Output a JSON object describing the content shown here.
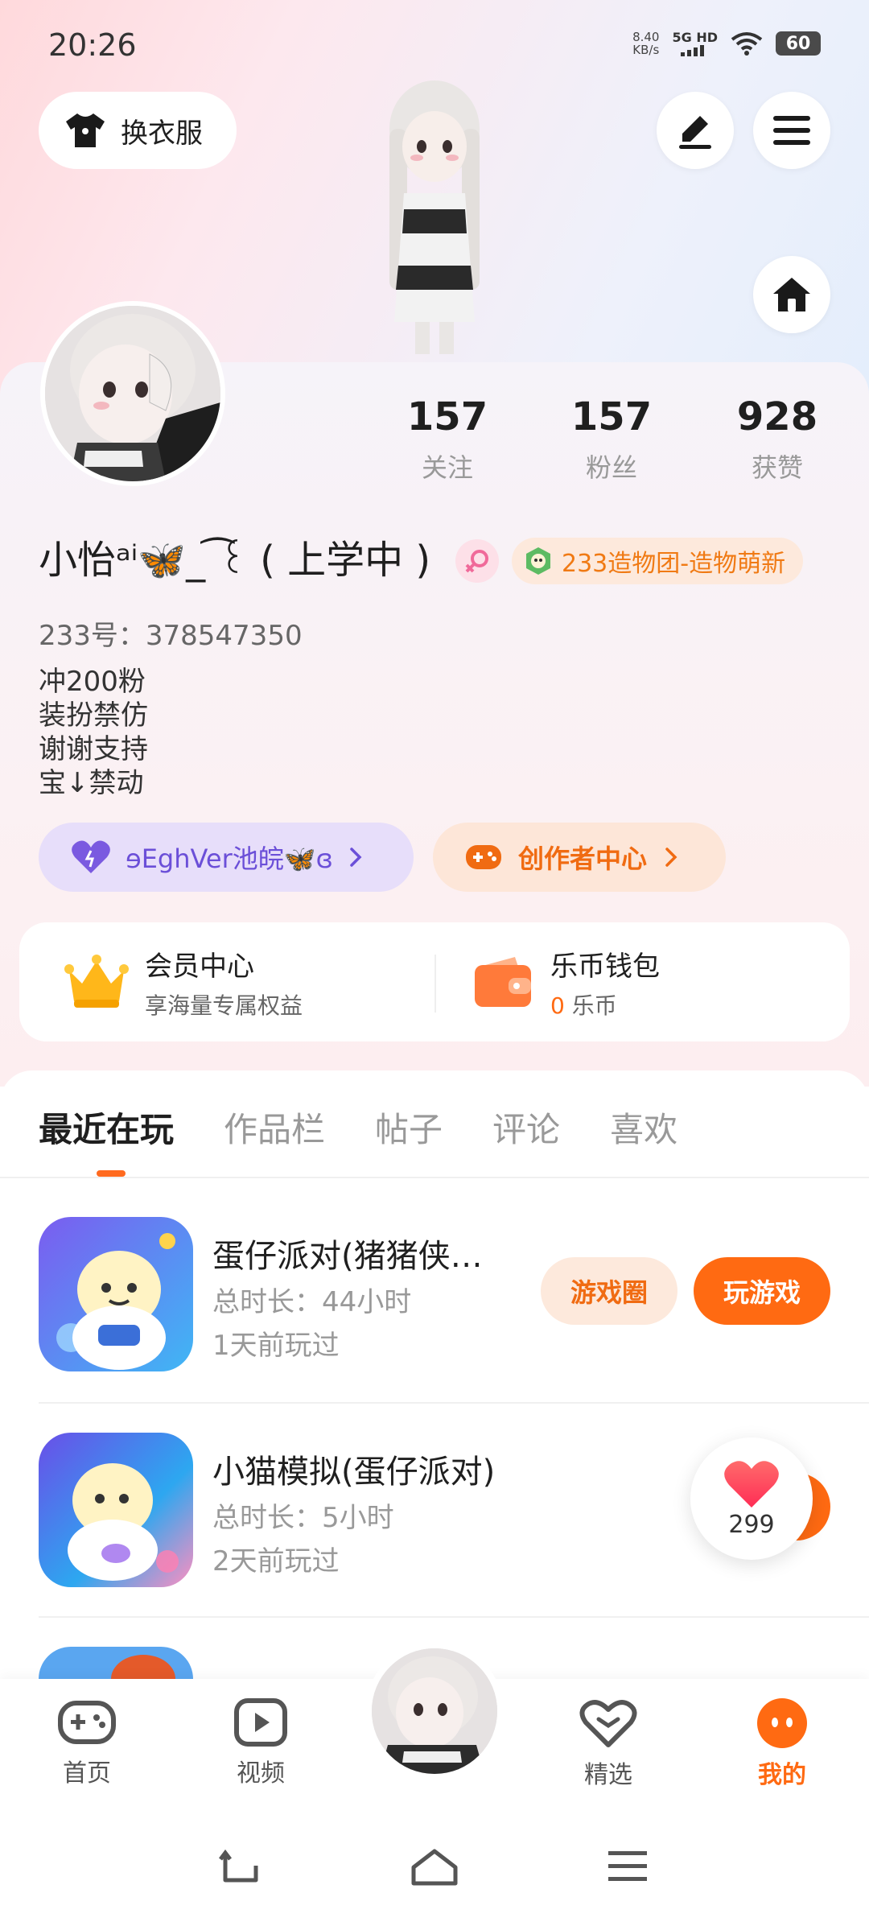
{
  "status_bar": {
    "time": "20:26",
    "net_speed_value": "8.40",
    "net_speed_unit": "KB/s",
    "network": "5G HD",
    "battery": "60"
  },
  "header": {
    "outfit_label": "换衣服"
  },
  "profile": {
    "stats": [
      {
        "value": "157",
        "label": "关注"
      },
      {
        "value": "157",
        "label": "粉丝"
      },
      {
        "value": "928",
        "label": "获赞"
      }
    ],
    "username": "小怡ᵃⁱ🦋_ ͡꒰ ( 上学中 )",
    "team_badge": "233造物团-造物萌新",
    "user_id": "233号：378547350",
    "bio": [
      "冲200粉",
      "装扮禁仿",
      "谢谢支持",
      "宝↓禁动"
    ],
    "fan_group": "ɘEghVer池皖🦋ɞ",
    "creator_center": "创作者中心"
  },
  "services": {
    "member_title": "会员中心",
    "member_sub": "享海量专属权益",
    "wallet_title": "乐币钱包",
    "wallet_amount": "0",
    "wallet_unit": "乐币"
  },
  "tabs": [
    "最近在玩",
    "作品栏",
    "帖子",
    "评论",
    "喜欢"
  ],
  "games": [
    {
      "title": "蛋仔派对(猪猪侠…",
      "duration": "总时长：44小时",
      "last_played": "1天前玩过",
      "circle_label": "游戏圈",
      "play_label": "玩游戏"
    },
    {
      "title": "小猫模拟(蛋仔派对)",
      "duration": "总时长：5小时",
      "last_played": "2天前玩过",
      "circle_label": "",
      "play_label": ""
    },
    {
      "title": "",
      "duration": "",
      "last_played": "",
      "circle_label": "",
      "play_label": ""
    }
  ],
  "like_bubble": {
    "count": "299"
  },
  "bottom_nav": [
    {
      "label": "首页",
      "icon": "gamepad-icon"
    },
    {
      "label": "视频",
      "icon": "play-icon"
    },
    {
      "label": "",
      "icon": "avatar"
    },
    {
      "label": "精选",
      "icon": "heart-game-icon"
    },
    {
      "label": "我的",
      "icon": "me-icon"
    }
  ],
  "colors": {
    "accent": "#ff6a12",
    "accent_light": "#fde9dc",
    "purple": "#6b4fd8",
    "purple_light": "#e7defa"
  }
}
